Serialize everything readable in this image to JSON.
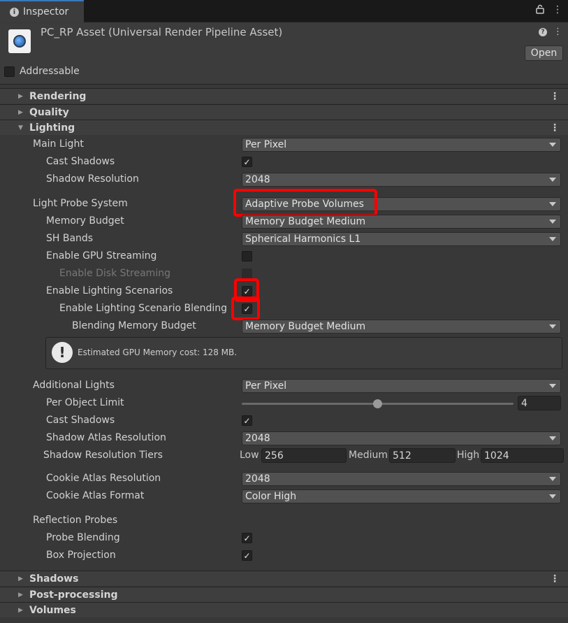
{
  "tab": {
    "title": "Inspector"
  },
  "header": {
    "asset_title": "PC_RP Asset (Universal Render Pipeline Asset)",
    "open_label": "Open",
    "addressable_label": "Addressable"
  },
  "sections": {
    "rendering": "Rendering",
    "quality": "Quality",
    "lighting": "Lighting",
    "shadows": "Shadows",
    "postprocessing": "Post-processing",
    "volumes": "Volumes"
  },
  "lighting": {
    "main_light": {
      "label": "Main Light",
      "value": "Per Pixel"
    },
    "cast_shadows": {
      "label": "Cast Shadows",
      "checked": true
    },
    "shadow_resolution": {
      "label": "Shadow Resolution",
      "value": "2048"
    },
    "light_probe_system": {
      "label": "Light Probe System",
      "value": "Adaptive Probe Volumes"
    },
    "memory_budget": {
      "label": "Memory Budget",
      "value": "Memory Budget Medium"
    },
    "sh_bands": {
      "label": "SH Bands",
      "value": "Spherical Harmonics L1"
    },
    "gpu_streaming": {
      "label": "Enable GPU Streaming",
      "checked": false
    },
    "disk_streaming": {
      "label": "Enable Disk Streaming",
      "checked": false
    },
    "lighting_scenarios": {
      "label": "Enable Lighting Scenarios",
      "checked": true
    },
    "scenario_blending": {
      "label": "Enable Lighting Scenario Blending",
      "checked": true
    },
    "blending_memory_budget": {
      "label": "Blending Memory Budget",
      "value": "Memory Budget Medium"
    },
    "gpu_memory_note": "Estimated GPU Memory cost: 128 MB.",
    "additional_lights": {
      "label": "Additional Lights",
      "value": "Per Pixel"
    },
    "per_object_limit": {
      "label": "Per Object Limit",
      "value": "4"
    },
    "add_cast_shadows": {
      "label": "Cast Shadows",
      "checked": true
    },
    "shadow_atlas_resolution": {
      "label": "Shadow Atlas Resolution",
      "value": "2048"
    },
    "shadow_resolution_tiers": {
      "label": "Shadow Resolution Tiers",
      "low_label": "Low",
      "low": "256",
      "medium_label": "Medium",
      "medium": "512",
      "high_label": "High",
      "high": "1024"
    },
    "cookie_atlas_resolution": {
      "label": "Cookie Atlas Resolution",
      "value": "2048"
    },
    "cookie_atlas_format": {
      "label": "Cookie Atlas Format",
      "value": "Color High"
    },
    "reflection_probes": {
      "label": "Reflection Probes"
    },
    "probe_blending": {
      "label": "Probe Blending",
      "checked": true
    },
    "box_projection": {
      "label": "Box Projection",
      "checked": true
    }
  },
  "icons": {
    "check": "✓",
    "info": "i",
    "lock": "lock-icon",
    "kebab": "⋮",
    "help": "?",
    "warning": "!"
  },
  "colors": {
    "highlight": "#ff0000",
    "tab_accent": "#3a79bb",
    "background": "#383838"
  }
}
